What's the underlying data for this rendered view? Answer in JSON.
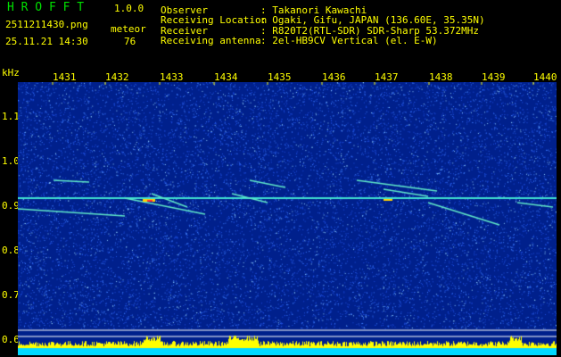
{
  "header": {
    "app_name": "H R O F F T",
    "version": "1.0.0",
    "filename": "2511211430.png",
    "datetime": "25.11.21 14:30",
    "meteor_label": "meteor",
    "meteor_count": "76",
    "info": [
      {
        "key": "Observer",
        "value": ": Takanori Kawachi"
      },
      {
        "key": "Receiving Location",
        "value": ": Ogaki, Gifu, JAPAN (136.60E, 35.35N)"
      },
      {
        "key": "Receiver",
        "value": ": R820T2(RTL-SDR) SDR-Sharp 53.372MHz"
      },
      {
        "key": "Receiving antenna",
        "value": ": 2el-HB9CV Vertical (el. E-W)"
      }
    ]
  },
  "spectrogram": {
    "unit": "kHz",
    "x_ticks": [
      "1431",
      "1432",
      "1433",
      "1434",
      "1435",
      "1436",
      "1437",
      "1438",
      "1439",
      "1440"
    ],
    "y_ticks": [
      "1.1",
      "1.0",
      "0.9",
      "0.8",
      "0.7",
      "0.6"
    ],
    "colors": {
      "background": "#00208c",
      "text_yellow": "#ffff00",
      "text_green": "#00e000",
      "signal": "#40e0d0"
    }
  }
}
